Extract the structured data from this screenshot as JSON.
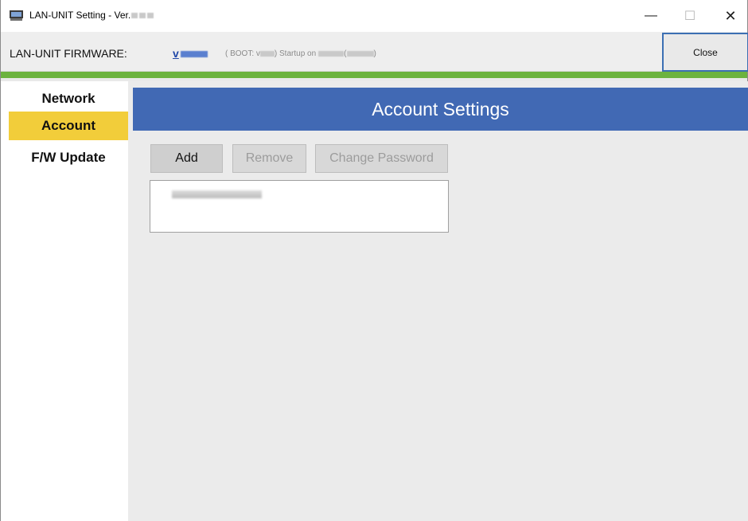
{
  "window": {
    "title": "LAN-UNIT Setting - Ver.",
    "minimize_glyph": "—",
    "maximize_glyph": "☐",
    "close_glyph": "✕"
  },
  "firmware_bar": {
    "label": "LAN-UNIT FIRMWARE:",
    "version_prefix": "v",
    "boot_text": "( BOOT: v",
    "startup_text": ") Startup on",
    "paren_open": "(",
    "paren_close": ")",
    "close_button": "Close"
  },
  "sidebar": {
    "items": [
      {
        "label": "Network"
      },
      {
        "label": "Account"
      },
      {
        "label": "F/W Update"
      }
    ]
  },
  "main": {
    "header": "Account Settings",
    "buttons": {
      "add": "Add",
      "remove": "Remove",
      "change_password": "Change Password"
    }
  },
  "colors": {
    "header_blue": "#4169b4",
    "active_nav": "#f2cd3a",
    "accent_green": "#6cb33f",
    "version_link": "#2148a8"
  },
  "icons": {
    "app": "lan-unit-app-icon"
  }
}
